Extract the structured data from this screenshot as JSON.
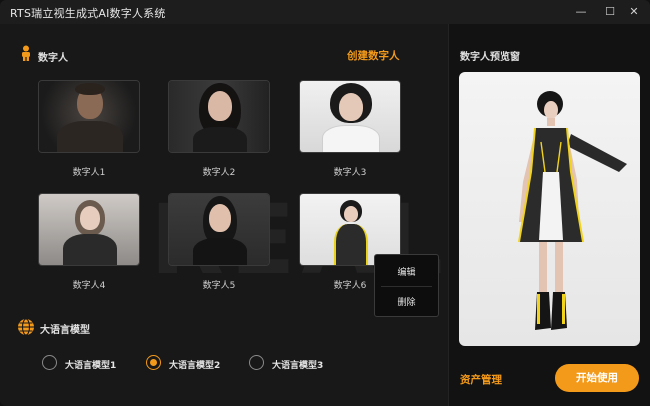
{
  "window": {
    "title": "RTS瑞立视生成式AI数字人系统",
    "minimize_glyph": "—",
    "maximize_glyph": "☐",
    "close_glyph": "✕"
  },
  "digital_humans": {
    "section_title": "数字人",
    "create_label": "创建数字人",
    "items": [
      {
        "label": "数字人1"
      },
      {
        "label": "数字人2"
      },
      {
        "label": "数字人3"
      },
      {
        "label": "数字人4"
      },
      {
        "label": "数字人5"
      },
      {
        "label": "数字人6"
      }
    ]
  },
  "context_menu": {
    "edit_label": "编辑",
    "delete_label": "删除"
  },
  "llm": {
    "section_title": "大语言模型",
    "options": [
      {
        "label": "大语言模型1",
        "checked": false
      },
      {
        "label": "大语言模型2",
        "checked": true
      },
      {
        "label": "大语言模型3",
        "checked": false
      }
    ]
  },
  "preview": {
    "title": "数字人预览窗"
  },
  "footer": {
    "asset_label": "资产管理",
    "start_label": "开始使用"
  },
  "colors": {
    "accent": "#f39a1b",
    "background": "#181818"
  }
}
